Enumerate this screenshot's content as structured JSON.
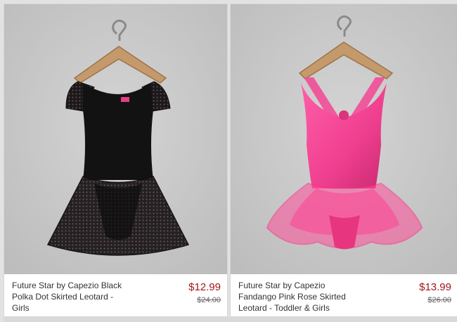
{
  "products": [
    {
      "title": "Future Star by Capezio Black Polka Dot Skirted Leotard - Girls",
      "price": "$12.99",
      "original_price": "$24.00",
      "image_icon": "black-leotard-on-hanger"
    },
    {
      "title": "Future Star by Capezio Fandango Pink Rose Skirted Leotard - Toddler & Girls",
      "price": "$13.99",
      "original_price": "$26.00",
      "image_icon": "pink-leotard-on-hanger"
    }
  ],
  "colors": {
    "sale_price": "#a3171c",
    "photo_background": "#c9c9c9"
  }
}
